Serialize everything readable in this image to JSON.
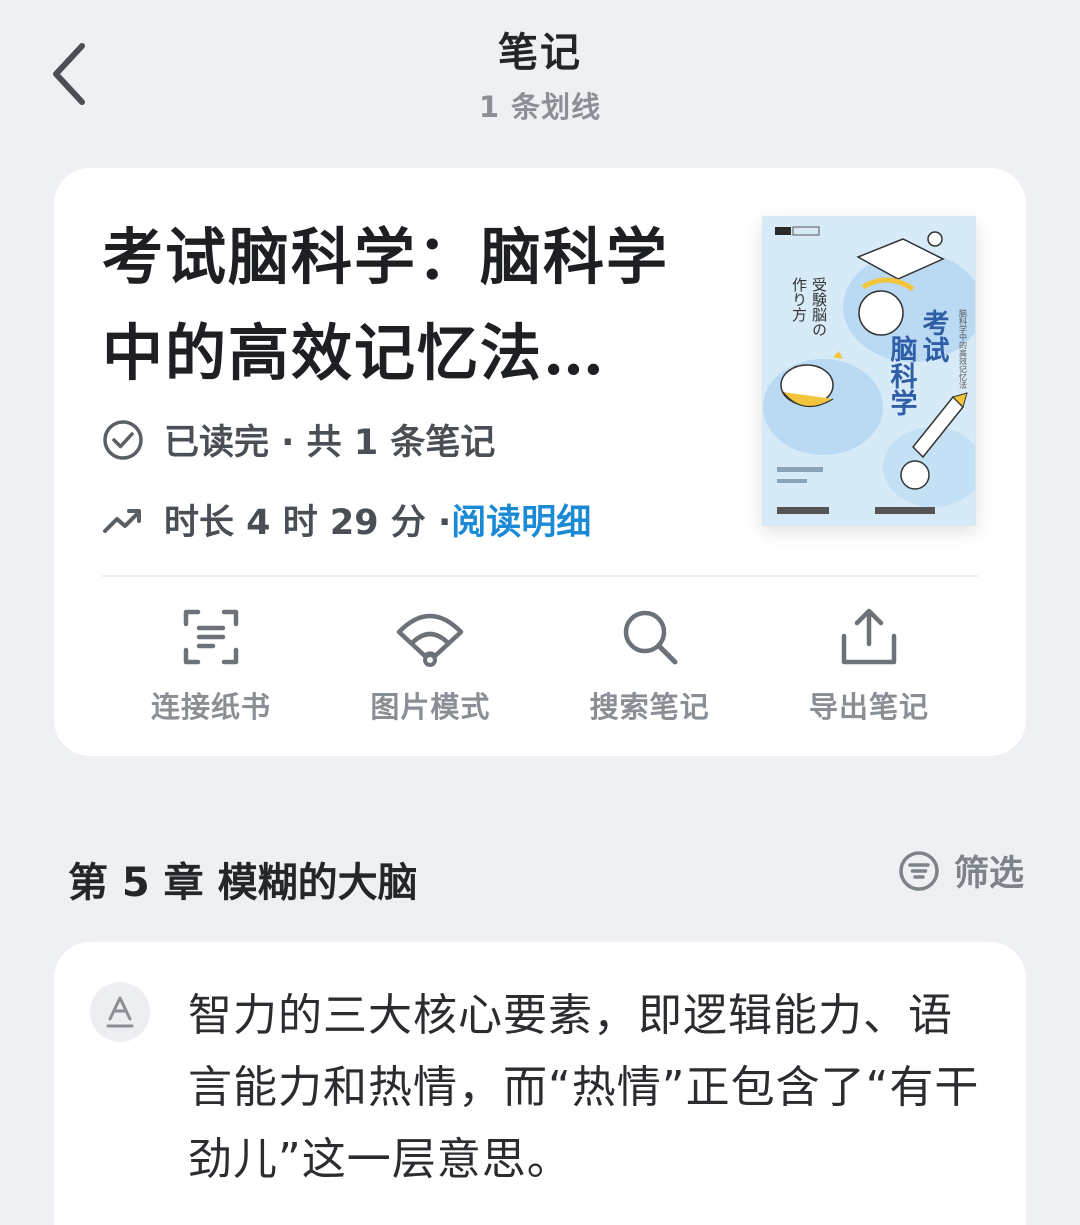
{
  "header": {
    "title": "笔记",
    "subtitle": "1 条划线"
  },
  "book": {
    "title": "考试脑科学：脑科学中的高效记忆法…",
    "status_text": "已读完 · 共 1 条笔记",
    "duration_text": "时长 4 时 29 分 · ",
    "read_detail_label": "阅读明细",
    "cover": {
      "main_title": "考试脑科学",
      "jp_title": "受験脳の作り方",
      "subtitle": "脑科学中的高效记忆法",
      "colors": {
        "background": "#cfe5f6",
        "title": "#2f5ea6",
        "accent": "#f2c53d"
      }
    }
  },
  "actions": [
    {
      "label": "连接纸书",
      "icon": "scan-icon"
    },
    {
      "label": "图片模式",
      "icon": "fan-icon"
    },
    {
      "label": "搜索笔记",
      "icon": "search-icon"
    },
    {
      "label": "导出笔记",
      "icon": "export-icon"
    }
  ],
  "chapter": {
    "title": "第 5 章  模糊的大脑",
    "filter_label": "筛选"
  },
  "note": {
    "badge_icon": "underline-a-icon",
    "text": "智力的三大核心要素，即逻辑能力、语言能力和热情，而“热情”正包含了“有干劲儿”这一层意思。"
  },
  "colors": {
    "background": "#eef0f3",
    "card": "#ffffff",
    "link": "#1b8ad6",
    "muted": "#8a8f96"
  }
}
